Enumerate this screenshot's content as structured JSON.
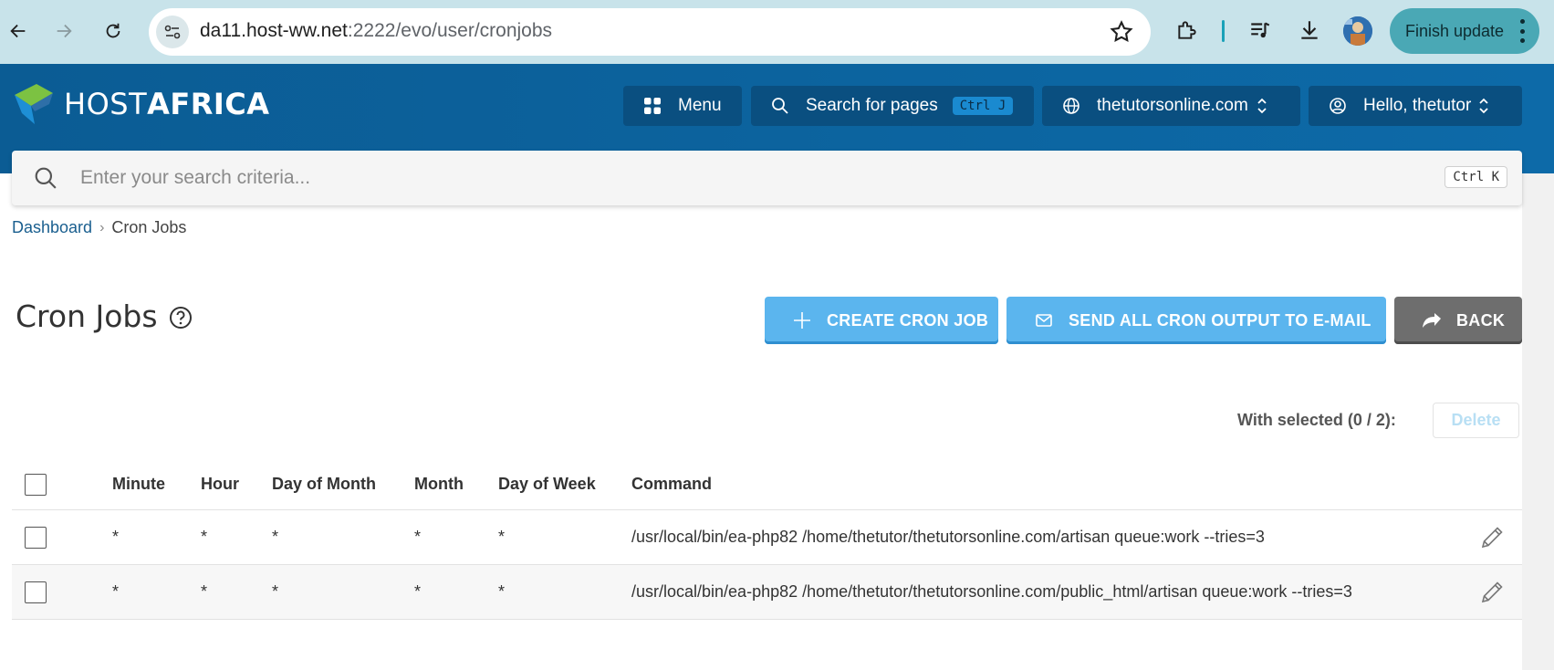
{
  "browser": {
    "url_host": "da11.host-ww.net",
    "url_rest": ":2222/evo/user/cronjobs",
    "finish_update": "Finish update"
  },
  "header": {
    "logo_host": "HOST",
    "logo_africa": "AFRICA",
    "menu_label": "Menu",
    "search_pages_label": "Search for pages",
    "search_pages_kbd": "Ctrl J",
    "domain_label": "thetutorsonline.com",
    "user_label": "Hello, thetutor"
  },
  "search": {
    "placeholder": "Enter your search criteria...",
    "kbd": "Ctrl K"
  },
  "breadcrumb": {
    "home": "Dashboard",
    "current": "Cron Jobs"
  },
  "page": {
    "title": "Cron Jobs",
    "create_label": "CREATE CRON JOB",
    "send_label": "SEND ALL CRON OUTPUT TO E-MAIL",
    "back_label": "BACK",
    "with_selected": "With selected (0 / 2):",
    "delete_label": "Delete"
  },
  "table": {
    "headers": [
      "Minute",
      "Hour",
      "Day of Month",
      "Month",
      "Day of Week",
      "Command"
    ],
    "rows": [
      {
        "minute": "*",
        "hour": "*",
        "dom": "*",
        "month": "*",
        "dow": "*",
        "command": "/usr/local/bin/ea-php82 /home/thetutor/thetutorsonline.com/artisan queue:work --tries=3"
      },
      {
        "minute": "*",
        "hour": "*",
        "dom": "*",
        "month": "*",
        "dow": "*",
        "command": "/usr/local/bin/ea-php82 /home/thetutor/thetutorsonline.com/public_html/artisan queue:work --tries=3"
      }
    ]
  },
  "colors": {
    "header_bg": "#0d6aa8",
    "primary_button": "#5bb5ee",
    "back_button": "#6e6e6e"
  }
}
